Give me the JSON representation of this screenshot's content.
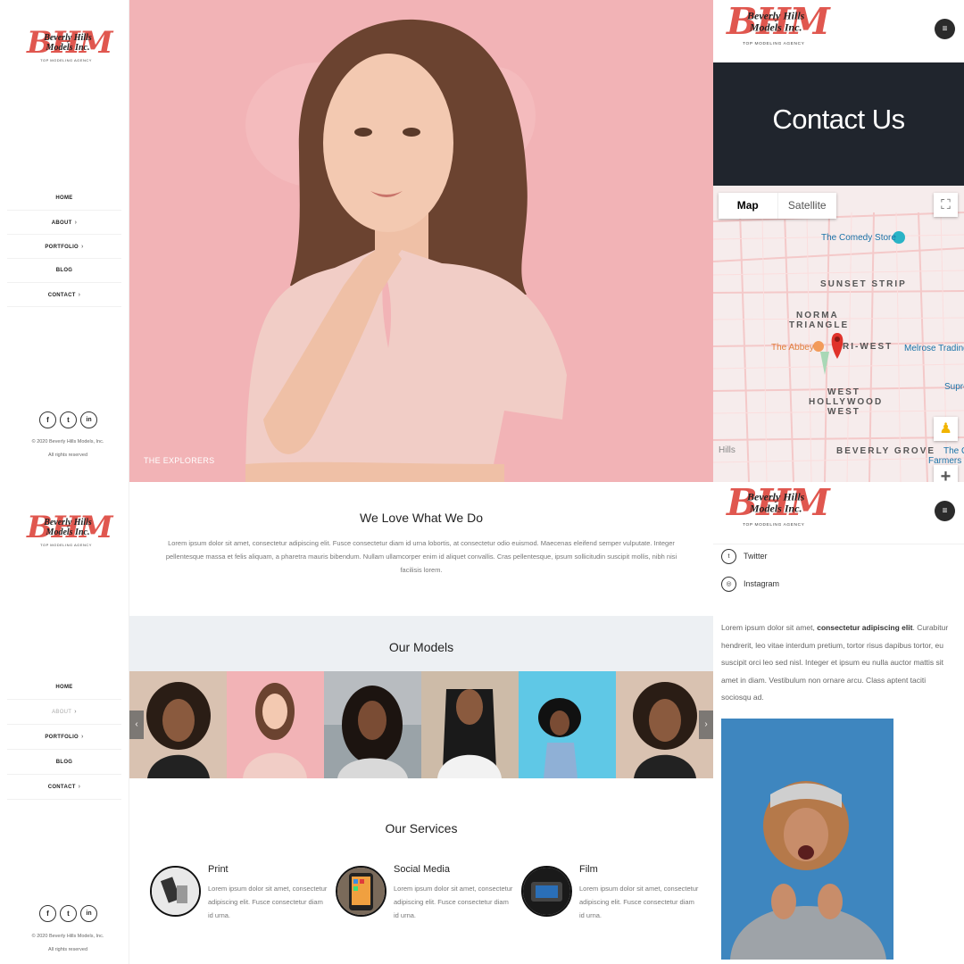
{
  "brand": {
    "logo_letters": "BHM",
    "logo_name_line1": "Beverly Hills",
    "logo_name_line2": "Models Inc.",
    "logo_tagline": "TOP MODELING AGENCY"
  },
  "sidebar_top": {
    "nav": [
      {
        "label": "HOME",
        "active": true,
        "has_children": false
      },
      {
        "label": "ABOUT",
        "active": false,
        "has_children": true
      },
      {
        "label": "PORTFOLIO",
        "active": false,
        "has_children": true
      },
      {
        "label": "BLOG",
        "active": false,
        "has_children": false
      },
      {
        "label": "CONTACT",
        "active": false,
        "has_children": true
      }
    ],
    "social_icons": [
      "facebook-icon",
      "twitter-icon",
      "linkedin-icon"
    ],
    "social_glyphs": [
      "f",
      "t",
      "in"
    ],
    "copyright_line1": "© 2020 Beverly Hills Models, Inc.",
    "copyright_line2": "All rights reserved"
  },
  "sidebar_bottom": {
    "nav": [
      {
        "label": "HOME",
        "active": false,
        "has_children": false
      },
      {
        "label": "ABOUT",
        "active": true,
        "has_children": true
      },
      {
        "label": "PORTFOLIO",
        "active": false,
        "has_children": true
      },
      {
        "label": "BLOG",
        "active": false,
        "has_children": false
      },
      {
        "label": "CONTACT",
        "active": false,
        "has_children": true
      }
    ],
    "copyright_line1": "© 2020 Beverly Hills Models, Inc.",
    "copyright_line2": "All rights reserved"
  },
  "hero": {
    "caption": "THE EXPLORERS",
    "background_color": "#f2b3b6"
  },
  "contact_page": {
    "title": "Contact Us",
    "menu_icon": "hamburger-icon",
    "map": {
      "tab_map": "Map",
      "tab_satellite": "Satellite",
      "labels": {
        "comedy_store": "The Comedy Store",
        "sunset_strip": "SUNSET STRIP",
        "norma_1": "NORMA",
        "norma_2": "TRIANGLE",
        "the_abbey": "The Abbey",
        "tri_west": "RI-WEST",
        "melrose": "Melrose Trading",
        "supreme": "Supre",
        "west_1": "WEST",
        "west_2": "HOLLYWOOD",
        "west_3": "WEST",
        "hills": "Hills",
        "beverly_grove": "BEVERLY GROVE",
        "farmers_1": "The O",
        "farmers_2": "Farmers M"
      }
    }
  },
  "home": {
    "love_title": "We Love What We Do",
    "love_text": "Lorem ipsum dolor sit amet, consectetur adipiscing elit. Fusce consectetur diam id urna lobortis, at consectetur odio euismod. Maecenas eleifend semper vulputate. Integer pellentesque massa et felis aliquam, a pharetra mauris bibendum. Nullam ullamcorper enim id aliquet convallis. Cras pellentesque, ipsum sollicitudin suscipit mollis, nibh nisi facilisis lorem.",
    "models_title": "Our Models",
    "services_title": "Our Services",
    "services": [
      {
        "title": "Print",
        "desc": "Lorem ipsum dolor sit amet, consectetur adipiscing elit. Fusce consectetur diam id urna."
      },
      {
        "title": "Social Media",
        "desc": "Lorem ipsum dolor sit amet, consectetur adipiscing elit. Fusce consectetur diam id urna."
      },
      {
        "title": "Film",
        "desc": "Lorem ipsum dolor sit amet, consectetur adipiscing elit. Fusce consectetur diam id urna."
      }
    ]
  },
  "right_panel": {
    "links": [
      {
        "label": "Twitter",
        "icon": "twitter-icon",
        "glyph": "t"
      },
      {
        "label": "Instagram",
        "icon": "instagram-icon",
        "glyph": "◎"
      }
    ],
    "text_before": "Lorem ipsum dolor sit amet, ",
    "text_bold": "consectetur adipiscing elit",
    "text_after": ". Curabitur hendrerit, leo vitae interdum pretium, tortor risus dapibus tortor, eu suscipit orci leo sed nisl. Integer et ipsum eu nulla auctor mattis sit amet in diam. Vestibulum non ornare arcu. Class aptent taciti sociosqu ad."
  },
  "colors": {
    "brand_red": "#e0574f",
    "dark_banner": "#20252d",
    "models_band": "#edf0f3"
  }
}
